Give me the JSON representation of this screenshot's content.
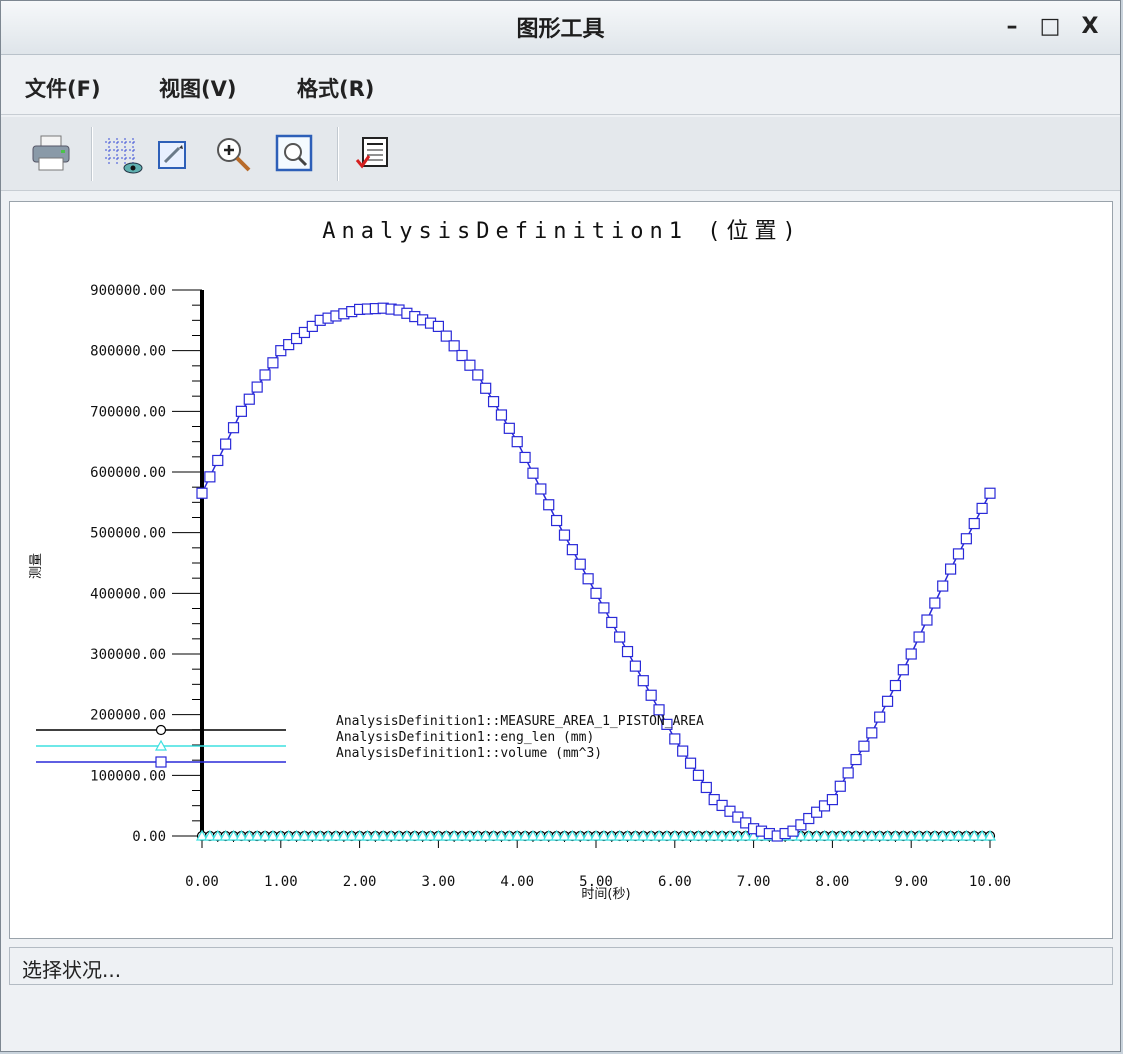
{
  "window": {
    "title": "图形工具"
  },
  "window_controls": {
    "minimize": "–",
    "maximize": "□",
    "close": "X"
  },
  "menu": {
    "file": "文件(F)",
    "view": "视图(V)",
    "format": "格式(R)"
  },
  "status": {
    "text": "选择状况..."
  },
  "colors": {
    "black_series": "#000000",
    "cyan_series": "#3ee0e0",
    "blue_series": "#2a2ad8"
  },
  "chart_data": {
    "type": "line",
    "title": "AnalysisDefinition1 (位置)",
    "xlabel": "时间(秒)",
    "ylabel": "测量",
    "xlim": [
      0,
      10
    ],
    "ylim": [
      0,
      900000
    ],
    "x_ticks": [
      "0.00",
      "1.00",
      "2.00",
      "3.00",
      "4.00",
      "5.00",
      "6.00",
      "7.00",
      "8.00",
      "9.00",
      "10.00"
    ],
    "y_ticks": [
      "0.00",
      "100000.00",
      "200000.00",
      "300000.00",
      "400000.00",
      "500000.00",
      "600000.00",
      "700000.00",
      "800000.00",
      "900000.00"
    ],
    "legend_position": "bottom-left",
    "series": [
      {
        "name": "AnalysisDefinition1::MEASURE_AREA_1_PISTON_AREA",
        "marker": "circle",
        "color": "#000000",
        "values": "constant 0 for x 0–10",
        "x": [
          0,
          10
        ],
        "y": [
          0,
          0
        ]
      },
      {
        "name": "AnalysisDefinition1::eng_len (mm)",
        "marker": "triangle",
        "color": "#3ee0e0",
        "x": [
          0,
          10
        ],
        "y": [
          0,
          0
        ]
      },
      {
        "name": "AnalysisDefinition1::volume (mm^3)",
        "marker": "square",
        "color": "#2a2ad8",
        "x": [
          0,
          0.5,
          1,
          1.5,
          2,
          2.3,
          2.5,
          3,
          3.5,
          4,
          4.5,
          5,
          5.5,
          6,
          6.5,
          7,
          7.3,
          7.5,
          8,
          8.5,
          9,
          9.5,
          10
        ],
        "y": [
          565000,
          700000,
          800000,
          850000,
          868000,
          870000,
          867000,
          840000,
          760000,
          650000,
          520000,
          400000,
          280000,
          160000,
          60000,
          12000,
          0,
          8000,
          60000,
          170000,
          300000,
          440000,
          565000
        ]
      }
    ]
  }
}
